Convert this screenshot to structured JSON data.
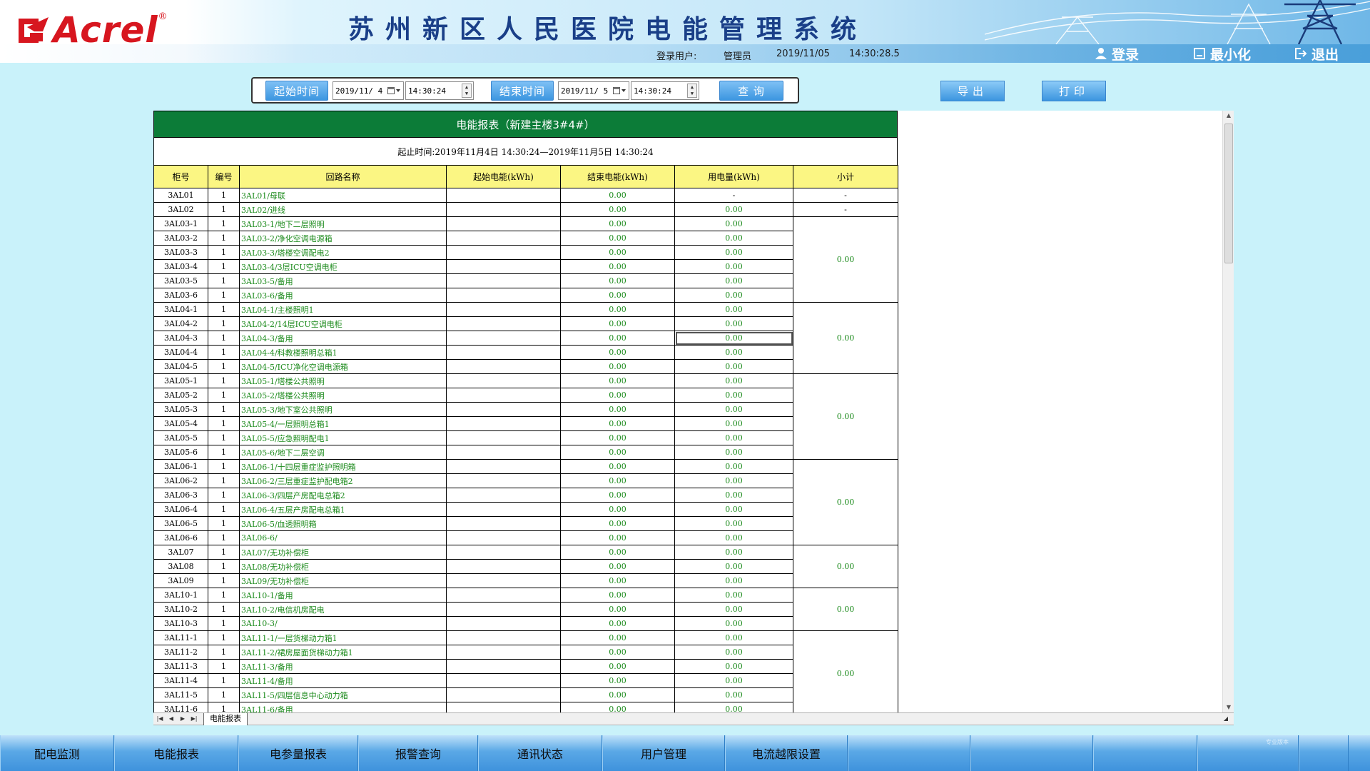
{
  "brand": {
    "name": "Acrel",
    "reg_mark": "®",
    "red": "#d7161f"
  },
  "app_title": "苏州新区人民医院电能管理系统",
  "header": {
    "user_label": "登录用户:",
    "user_name": "管理员",
    "date": "2019/11/05",
    "time": "14:30:28.5",
    "login_label": "登录",
    "minimize_label": "最小化",
    "logout_label": "退出"
  },
  "toolbar": {
    "start_button": "起始时间",
    "start_date": "2019/11/ 4",
    "start_time": "14:30:24",
    "end_button": "结束时间",
    "end_date": "2019/11/ 5",
    "end_time": "14:30:24",
    "query_button": "查 询",
    "export_button": "导出",
    "print_button": "打印"
  },
  "report": {
    "title": "电能报表（新建主楼3#4#）",
    "range": "起止时间:2019年11月4日 14:30:24—2019年11月5日 14:30:24",
    "headers": [
      "柜号",
      "编号",
      "回路名称",
      "起始电能(kWh)",
      "结束电能(kWh)",
      "用电量(kWh)",
      "小计"
    ],
    "rows": [
      {
        "cab": "3AL01",
        "no": "1",
        "name": "3AL01/母联",
        "start": "",
        "end": "0.00",
        "use": "-"
      },
      {
        "cab": "3AL02",
        "no": "1",
        "name": "3AL02/进线",
        "start": "",
        "end": "0.00",
        "use": "0.00"
      },
      {
        "cab": "3AL03-1",
        "no": "1",
        "name": "3AL03-1/地下二层照明",
        "start": "",
        "end": "0.00",
        "use": "0.00"
      },
      {
        "cab": "3AL03-2",
        "no": "1",
        "name": "3AL03-2/净化空调电源箱",
        "start": "",
        "end": "0.00",
        "use": "0.00"
      },
      {
        "cab": "3AL03-3",
        "no": "1",
        "name": "3AL03-3/塔楼空调配电2",
        "start": "",
        "end": "0.00",
        "use": "0.00"
      },
      {
        "cab": "3AL03-4",
        "no": "1",
        "name": "3AL03-4/3层ICU空调电柜",
        "start": "",
        "end": "0.00",
        "use": "0.00"
      },
      {
        "cab": "3AL03-5",
        "no": "1",
        "name": "3AL03-5/备用",
        "start": "",
        "end": "0.00",
        "use": "0.00"
      },
      {
        "cab": "3AL03-6",
        "no": "1",
        "name": "3AL03-6/备用",
        "start": "",
        "end": "0.00",
        "use": "0.00"
      },
      {
        "cab": "3AL04-1",
        "no": "1",
        "name": "3AL04-1/主楼照明1",
        "start": "",
        "end": "0.00",
        "use": "0.00"
      },
      {
        "cab": "3AL04-2",
        "no": "1",
        "name": "3AL04-2/14层ICU空调电柜",
        "start": "",
        "end": "0.00",
        "use": "0.00"
      },
      {
        "cab": "3AL04-3",
        "no": "1",
        "name": "3AL04-3/备用",
        "start": "",
        "end": "0.00",
        "use": "0.00"
      },
      {
        "cab": "3AL04-4",
        "no": "1",
        "name": "3AL04-4/科教楼照明总箱1",
        "start": "",
        "end": "0.00",
        "use": "0.00"
      },
      {
        "cab": "3AL04-5",
        "no": "1",
        "name": "3AL04-5/ICU净化空调电源箱",
        "start": "",
        "end": "0.00",
        "use": "0.00"
      },
      {
        "cab": "3AL05-1",
        "no": "1",
        "name": "3AL05-1/塔楼公共照明",
        "start": "",
        "end": "0.00",
        "use": "0.00"
      },
      {
        "cab": "3AL05-2",
        "no": "1",
        "name": "3AL05-2/塔楼公共照明",
        "start": "",
        "end": "0.00",
        "use": "0.00"
      },
      {
        "cab": "3AL05-3",
        "no": "1",
        "name": "3AL05-3/地下室公共照明",
        "start": "",
        "end": "0.00",
        "use": "0.00"
      },
      {
        "cab": "3AL05-4",
        "no": "1",
        "name": "3AL05-4/一层照明总箱1",
        "start": "",
        "end": "0.00",
        "use": "0.00"
      },
      {
        "cab": "3AL05-5",
        "no": "1",
        "name": "3AL05-5/应急照明配电1",
        "start": "",
        "end": "0.00",
        "use": "0.00"
      },
      {
        "cab": "3AL05-6",
        "no": "1",
        "name": "3AL05-6/地下二层空调",
        "start": "",
        "end": "0.00",
        "use": "0.00"
      },
      {
        "cab": "3AL06-1",
        "no": "1",
        "name": "3AL06-1/十四层重症监护照明箱",
        "start": "",
        "end": "0.00",
        "use": "0.00"
      },
      {
        "cab": "3AL06-2",
        "no": "1",
        "name": "3AL06-2/三层重症监护配电箱2",
        "start": "",
        "end": "0.00",
        "use": "0.00"
      },
      {
        "cab": "3AL06-3",
        "no": "1",
        "name": "3AL06-3/四层产房配电总箱2",
        "start": "",
        "end": "0.00",
        "use": "0.00"
      },
      {
        "cab": "3AL06-4",
        "no": "1",
        "name": "3AL06-4/五层产房配电总箱1",
        "start": "",
        "end": "0.00",
        "use": "0.00"
      },
      {
        "cab": "3AL06-5",
        "no": "1",
        "name": "3AL06-5/血透照明箱",
        "start": "",
        "end": "0.00",
        "use": "0.00"
      },
      {
        "cab": "3AL06-6",
        "no": "1",
        "name": "3AL06-6/",
        "start": "",
        "end": "0.00",
        "use": "0.00"
      },
      {
        "cab": "3AL07",
        "no": "1",
        "name": "3AL07/无功补偿柜",
        "start": "",
        "end": "0.00",
        "use": "0.00"
      },
      {
        "cab": "3AL08",
        "no": "1",
        "name": "3AL08/无功补偿柜",
        "start": "",
        "end": "0.00",
        "use": "0.00"
      },
      {
        "cab": "3AL09",
        "no": "1",
        "name": "3AL09/无功补偿柜",
        "start": "",
        "end": "0.00",
        "use": "0.00"
      },
      {
        "cab": "3AL10-1",
        "no": "1",
        "name": "3AL10-1/备用",
        "start": "",
        "end": "0.00",
        "use": "0.00"
      },
      {
        "cab": "3AL10-2",
        "no": "1",
        "name": "3AL10-2/电信机房配电",
        "start": "",
        "end": "0.00",
        "use": "0.00"
      },
      {
        "cab": "3AL10-3",
        "no": "1",
        "name": "3AL10-3/",
        "start": "",
        "end": "0.00",
        "use": "0.00"
      },
      {
        "cab": "3AL11-1",
        "no": "1",
        "name": "3AL11-1/一层货梯动力箱1",
        "start": "",
        "end": "0.00",
        "use": "0.00"
      },
      {
        "cab": "3AL11-2",
        "no": "1",
        "name": "3AL11-2/裙房屋面货梯动力箱1",
        "start": "",
        "end": "0.00",
        "use": "0.00"
      },
      {
        "cab": "3AL11-3",
        "no": "1",
        "name": "3AL11-3/备用",
        "start": "",
        "end": "0.00",
        "use": "0.00"
      },
      {
        "cab": "3AL11-4",
        "no": "1",
        "name": "3AL11-4/备用",
        "start": "",
        "end": "0.00",
        "use": "0.00"
      },
      {
        "cab": "3AL11-5",
        "no": "1",
        "name": "3AL11-5/四层信息中心动力箱",
        "start": "",
        "end": "0.00",
        "use": "0.00"
      },
      {
        "cab": "3AL11-6",
        "no": "1",
        "name": "3AL11-6/备用",
        "start": "",
        "end": "0.00",
        "use": "0.00"
      }
    ],
    "subtotals": [
      {
        "rows": 1,
        "value": "-"
      },
      {
        "rows": 1,
        "value": "-"
      },
      {
        "rows": 6,
        "value": "0.00"
      },
      {
        "rows": 5,
        "value": "0.00"
      },
      {
        "rows": 6,
        "value": "0.00"
      },
      {
        "rows": 6,
        "value": "0.00"
      },
      {
        "rows": 3,
        "value": "0.00"
      },
      {
        "rows": 3,
        "value": "0.00"
      },
      {
        "rows": 6,
        "value": "0.00"
      }
    ],
    "selected_row": 10,
    "sheet_tab": "电能报表"
  },
  "bottom_nav": [
    "配电监测",
    "电能报表",
    "电参量报表",
    "报警查询",
    "通讯状态",
    "用户管理",
    "电流越限设置",
    "",
    "",
    "",
    "",
    ""
  ],
  "footer_text": "专业版本"
}
